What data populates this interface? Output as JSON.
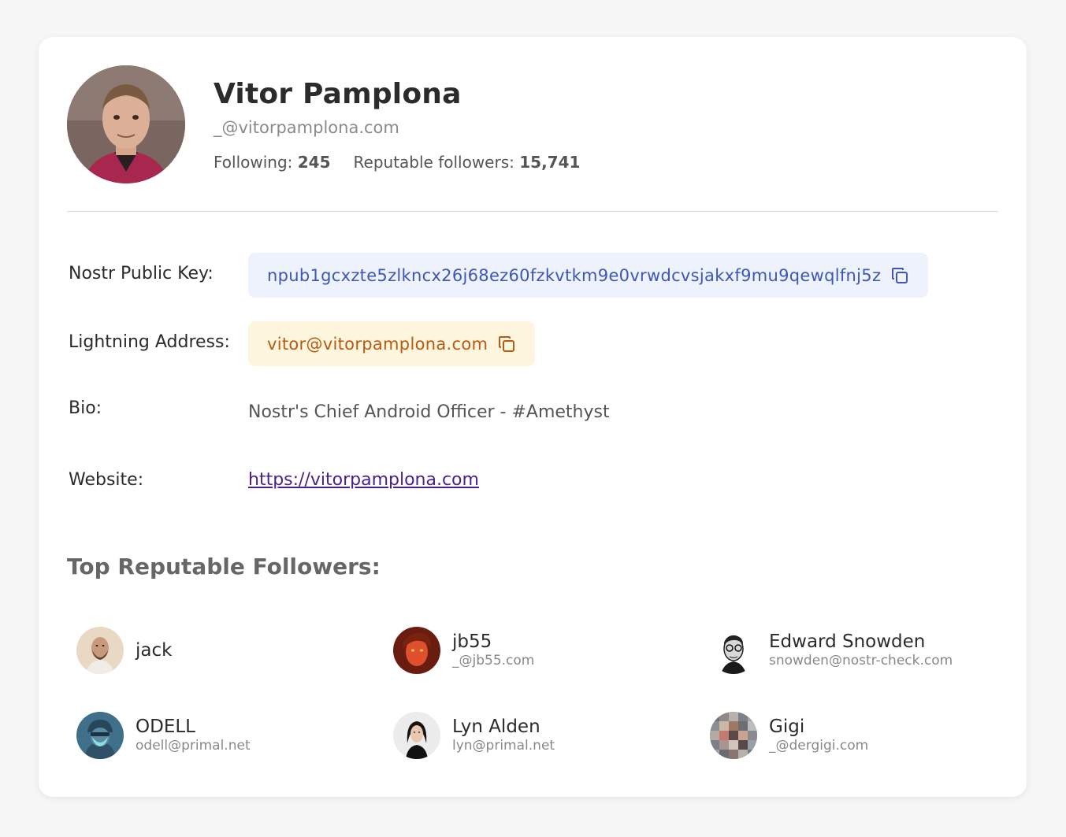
{
  "profile": {
    "name": "Vitor Pamplona",
    "handle": "_@vitorpamplona.com",
    "following_label": "Following:",
    "following_count": "245",
    "followers_label": "Reputable followers:",
    "followers_count": "15,741"
  },
  "details": {
    "npub_label": "Nostr Public Key:",
    "npub_value": "npub1gcxzte5zlkncx26j68ez60fzkvtkm9e0vrwdcvsjakxf9mu9qewqlfnj5z",
    "lightning_label": "Lightning Address:",
    "lightning_value": "vitor@vitorpamplona.com",
    "bio_label": "Bio:",
    "bio_value": "Nostr's Chief Android Officer - #Amethyst",
    "website_label": "Website:",
    "website_value": "https://vitorpamplona.com"
  },
  "followers_section": {
    "title": "Top Reputable Followers:",
    "items": [
      {
        "name": "jack",
        "handle": ""
      },
      {
        "name": "jb55",
        "handle": "_@jb55.com"
      },
      {
        "name": "Edward Snowden",
        "handle": "snowden@nostr-check.com"
      },
      {
        "name": "ODELL",
        "handle": "odell@primal.net"
      },
      {
        "name": "Lyn Alden",
        "handle": "lyn@primal.net"
      },
      {
        "name": "Gigi",
        "handle": "_@dergigi.com"
      }
    ]
  },
  "icons": {
    "copy_npub": "copy-icon",
    "copy_lightning": "copy-icon"
  },
  "colors": {
    "npub_bg": "#edf2fd",
    "npub_text": "#3d57b8",
    "lightning_bg": "#fdf5dd",
    "lightning_text": "#b75a12",
    "link": "#4a1f8f"
  }
}
